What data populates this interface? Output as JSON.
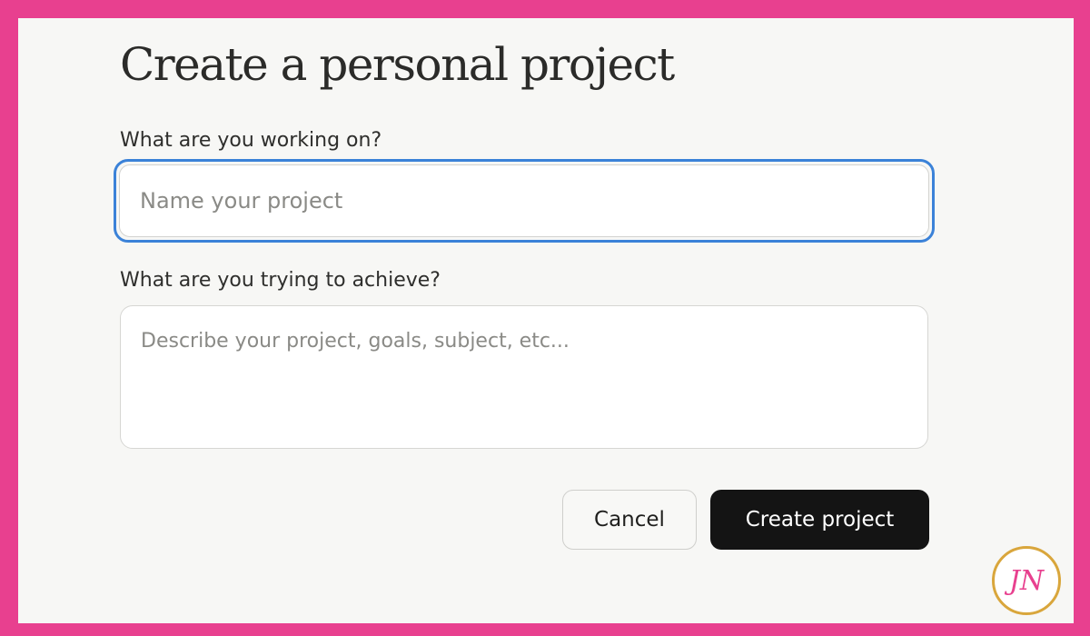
{
  "dialog": {
    "title": "Create a personal project",
    "name_field": {
      "label": "What are you working on?",
      "placeholder": "Name your project",
      "value": ""
    },
    "goal_field": {
      "label": "What are you trying to achieve?",
      "placeholder": "Describe your project, goals, subject, etc...",
      "value": ""
    },
    "buttons": {
      "cancel": "Cancel",
      "create": "Create project"
    }
  },
  "colors": {
    "frame": "#e8408f",
    "panel": "#f7f7f5",
    "focus_ring": "#3b82d8",
    "primary_button": "#141414",
    "logo_ring": "#d9a63c"
  },
  "logo": {
    "icon": "jn-monogram-logo",
    "text": "JN"
  }
}
